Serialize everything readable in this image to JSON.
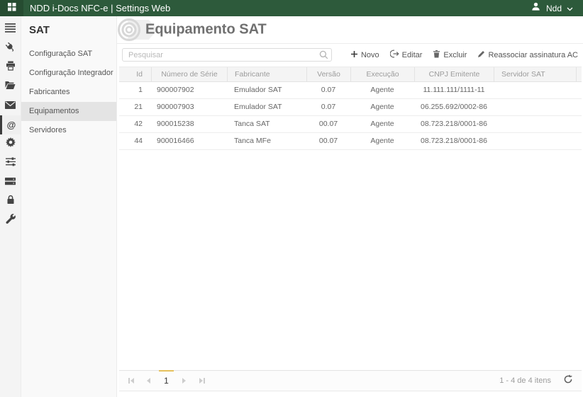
{
  "topbar": {
    "title": "NDD i-Docs NFC-e | Settings Web",
    "user": {
      "name": "Ndd"
    }
  },
  "icon_strip": {
    "icons": [
      "menu-icon",
      "plug-icon",
      "printer-icon",
      "folder-open-icon",
      "mail-icon",
      "at-sign-icon",
      "gear-icon",
      "sliders-icon",
      "server-icon",
      "lock-icon",
      "wrench-icon"
    ],
    "selected_icon": "at-sign-icon"
  },
  "sidebar": {
    "title": "SAT",
    "items": [
      {
        "label": "Configuração SAT",
        "selected": false
      },
      {
        "label": "Configuração Integrador",
        "selected": false
      },
      {
        "label": "Fabricantes",
        "selected": false
      },
      {
        "label": "Equipamentos",
        "selected": true
      },
      {
        "label": "Servidores",
        "selected": false
      }
    ]
  },
  "main": {
    "title": "Equipamento SAT",
    "search": {
      "placeholder": "Pesquisar",
      "value": "",
      "icon": "search-icon"
    },
    "toolbar": [
      {
        "label": "Novo",
        "icon": "plus-icon"
      },
      {
        "label": "Editar",
        "icon": "edit-icon"
      },
      {
        "label": "Excluir",
        "icon": "trash-icon"
      },
      {
        "label": "Reassociar assinatura AC",
        "icon": "pencil-icon"
      }
    ],
    "table": {
      "columns": [
        "Id",
        "Número de Série",
        "Fabricante",
        "Versão",
        "Execução",
        "CNPJ Emitente",
        "Servidor SAT"
      ],
      "rows": [
        [
          "1",
          "900007902",
          "Emulador SAT",
          "0.07",
          "Agente",
          "11.111.111/1111-11",
          ""
        ],
        [
          "21",
          "900007903",
          "Emulador SAT",
          "0.07",
          "Agente",
          "06.255.692/0002-86",
          ""
        ],
        [
          "42",
          "900015238",
          "Tanca SAT",
          "00.07",
          "Agente",
          "08.723.218/0001-86",
          ""
        ],
        [
          "44",
          "900016466",
          "Tanca MFe",
          "00.07",
          "Agente",
          "08.723.218/0001-86",
          ""
        ]
      ]
    },
    "pager": {
      "page": "1",
      "summary": "1 - 4 de 4 itens",
      "refresh_icon": "refresh-icon"
    }
  },
  "colors": {
    "topbar_bg": "#2d5a3b",
    "topbar_box_bg": "#264c31",
    "accent_page_indicator": "#e5c05c",
    "selected_item_bg": "#e4e4e4"
  }
}
